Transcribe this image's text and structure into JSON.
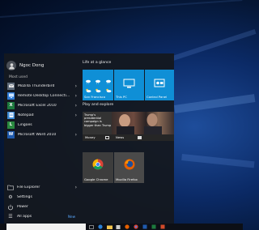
{
  "user": {
    "name": "Ngoc Dong"
  },
  "sections": {
    "most_used": "Most used",
    "life_at_a_glance": "Life at a glance",
    "play_and_explore": "Play and explore"
  },
  "apps": [
    {
      "label": "Mozilla Thunderbird",
      "icon": "thunderbird-icon",
      "color": "#5f6b7a"
    },
    {
      "label": "Remote Desktop Connecti...",
      "icon": "remote-desktop-icon",
      "color": "#2f7bd6"
    },
    {
      "label": "Microsoft Excel 2010",
      "icon": "excel-icon",
      "color": "#1d7a3e"
    },
    {
      "label": "Notepad",
      "icon": "notepad-icon",
      "color": "#3b88d2"
    },
    {
      "label": "Lingoes",
      "icon": "lingoes-icon",
      "color": "#2a8a3f"
    },
    {
      "label": "Microsoft Word 2010",
      "icon": "word-icon",
      "color": "#1f5aad"
    }
  ],
  "bottom": [
    {
      "label": "File Explorer",
      "icon": "folder-icon"
    },
    {
      "label": "Settings",
      "icon": "gear-icon"
    },
    {
      "label": "Power",
      "icon": "power-icon"
    },
    {
      "label": "All apps",
      "icon": "list-icon",
      "badge": "New"
    }
  ],
  "tiles": {
    "weather": {
      "label": "San Francisco"
    },
    "this_pc": {
      "label": "This PC"
    },
    "control_panel": {
      "label": "Control Panel"
    },
    "news_headline": "Trump's presidential campaign is bigger than Trump",
    "money": {
      "label": "Money"
    },
    "news": {
      "label": "News"
    },
    "chrome": {
      "label": "Google Chrome"
    },
    "firefox": {
      "label": "Mozilla Firefox"
    }
  },
  "colors": {
    "tile_blue": "#0f8fd6",
    "start_bg": "#14181f",
    "accent_new": "#5aa9ff"
  }
}
